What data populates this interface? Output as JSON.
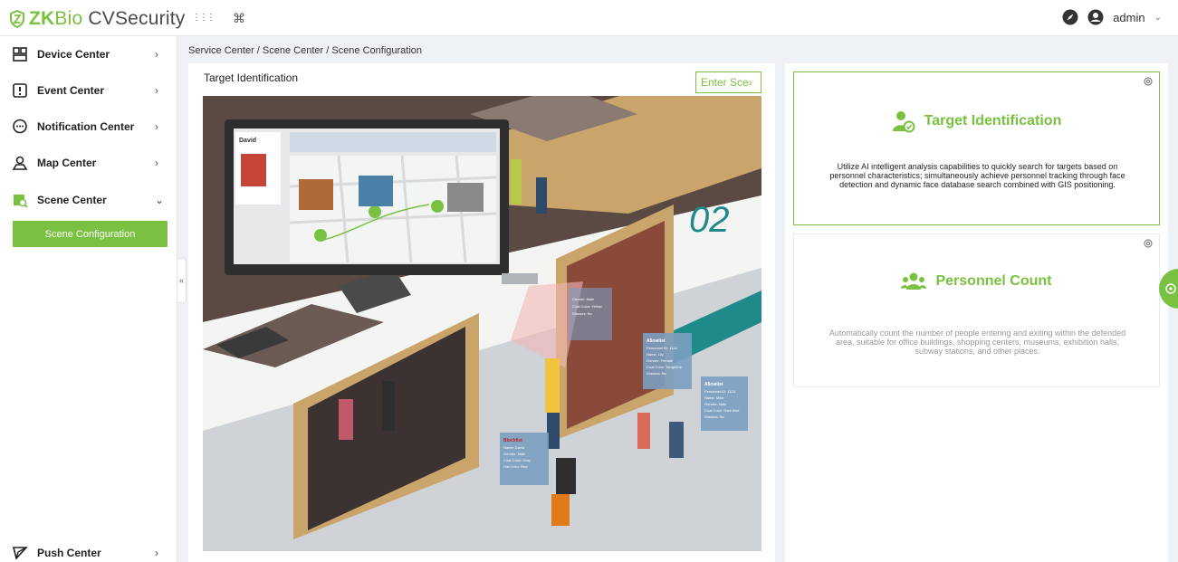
{
  "app": {
    "logo_text_zk": "ZK",
    "logo_text_bio": "Bio",
    "logo_text_rest": " CVSecurity",
    "user": "admin",
    "brand_color": "#7ac142"
  },
  "topbar": {
    "icons": [
      "grid-icon",
      "command-icon",
      "compass-icon",
      "user-circle-icon"
    ],
    "command_glyph": "⌘",
    "grid_glyph": "⋮⋮⋮",
    "caret_glyph": "⌄"
  },
  "sidebar": {
    "items": [
      {
        "label": "Device Center",
        "icon": "device-icon",
        "arrow": "›"
      },
      {
        "label": "Event Center",
        "icon": "event-icon",
        "arrow": "›"
      },
      {
        "label": "Notification Center",
        "icon": "notification-icon",
        "arrow": "›"
      },
      {
        "label": "Map Center",
        "icon": "map-icon",
        "arrow": "›"
      },
      {
        "label": "Scene Center",
        "icon": "scene-icon",
        "arrow": "⌄"
      }
    ],
    "sub_item": "Scene Configuration",
    "bottom_item": {
      "label": "Push Center",
      "icon": "push-icon",
      "arrow": "›"
    },
    "collapse_glyph": "«"
  },
  "breadcrumb": "Service Center / Scene Center / Scene Configuration",
  "main": {
    "title": "Target Identification",
    "enter_button": "Enter Sce›"
  },
  "cards": [
    {
      "title": "Target Identification",
      "icon": "target-person-icon",
      "description": "Utilize AI intelligent analysis capabilities to quickly search for targets based on personnel characteristics; simultaneously achieve personnel tracking through face detection and dynamic face database search combined with GIS positioning.",
      "selected": true
    },
    {
      "title": "Personnel Count",
      "icon": "people-group-icon",
      "description": "Automatically count the number of people entering and exiting within the defended area, suitable for office buildings, shopping centers, museums, exhibition halls, subway stations, and other places.",
      "selected": false
    }
  ],
  "illustration": {
    "monitor_name": "David",
    "wall_number": "02",
    "tags": [
      {
        "title": "Blocklist",
        "lines": [
          "Name: David",
          "Gender: Male",
          "Coat Color: Gray",
          "Hat Color: Red"
        ]
      },
      {
        "title": "Allowlist",
        "lines": [
          "Personnel ID: 1122",
          "Name: Lily",
          "Gender: Female",
          "Coat Color: Tangerine",
          "Glasses: No"
        ]
      },
      {
        "title": "Allowlist",
        "lines": [
          "Personnel ID: 1123",
          "Name: Mike",
          "Gender: Male",
          "Coat Color: Dark blue",
          "Glasses: No"
        ]
      },
      {
        "title": "",
        "lines": [
          "Gender: Male",
          "Coat Color: Yellow",
          "Glasses: No"
        ]
      }
    ]
  }
}
